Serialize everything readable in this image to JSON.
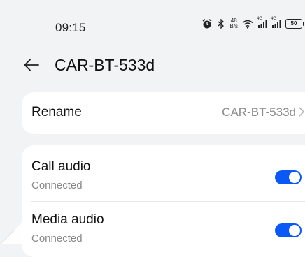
{
  "status_bar": {
    "time": "09:15",
    "net_speed_value": "48",
    "net_speed_unit": "B/s",
    "signal_label_1": "4G",
    "signal_label_2": "4G",
    "battery": "50",
    "icons": [
      "alarm-icon",
      "bluetooth-icon",
      "wifi-icon",
      "cellular-signal-icon",
      "cellular-signal-icon",
      "battery-icon"
    ]
  },
  "header": {
    "back_icon": "back-arrow-icon",
    "title": "CAR-BT-533d"
  },
  "rename": {
    "label": "Rename",
    "value": "CAR-BT-533d",
    "chevron_icon": "chevron-right-icon"
  },
  "audio": {
    "items": [
      {
        "title": "Call audio",
        "status": "Connected",
        "enabled": true
      },
      {
        "title": "Media audio",
        "status": "Connected",
        "enabled": true
      }
    ]
  },
  "colors": {
    "accent": "#0a59f7",
    "background": "#f1f3f5",
    "card": "#ffffff",
    "secondary_text": "#888888"
  }
}
